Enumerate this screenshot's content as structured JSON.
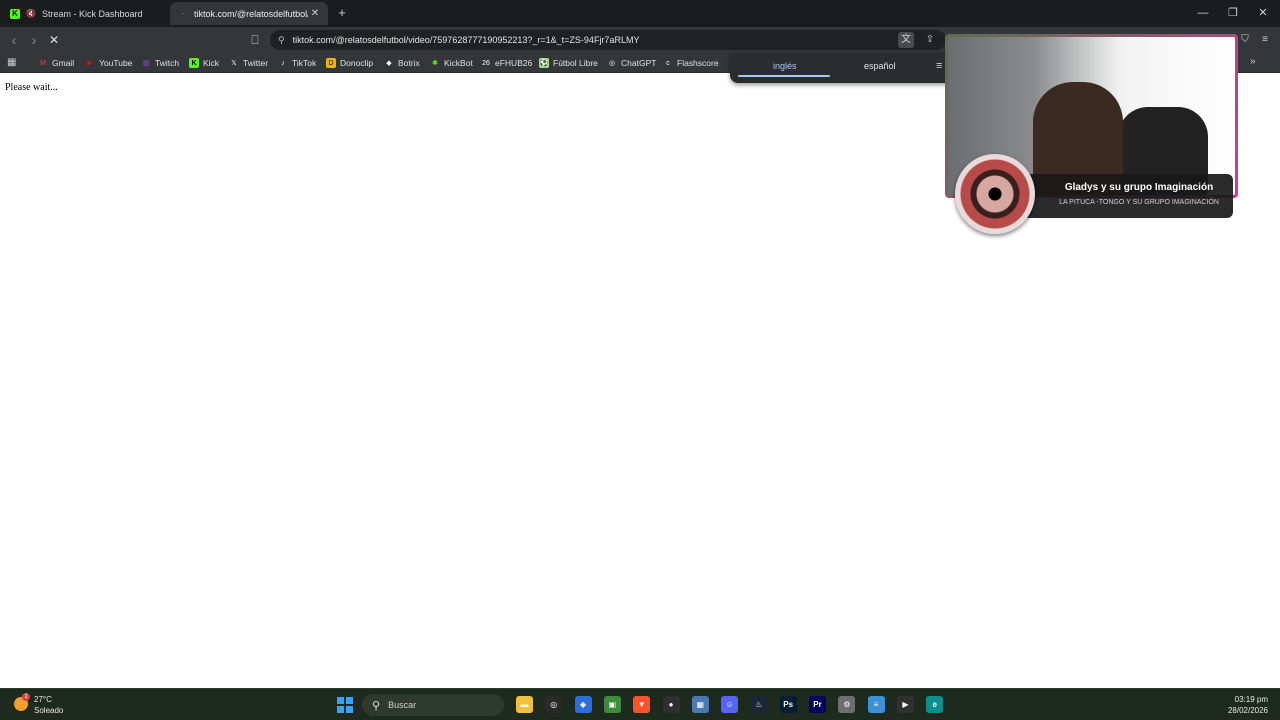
{
  "tabs": [
    {
      "title": "Stream - Kick Dashboard",
      "favicon": "kick-icon"
    },
    {
      "title": "tiktok.com/@relatosdelfutbol/v",
      "favicon": "loading-icon",
      "active": true
    }
  ],
  "toolbar": {
    "url": "tiktok.com/@relatosdelfutbol/video/7597628777190952213?_r=1&_t=ZS-94Fjr7aRLMY"
  },
  "bookmarks": [
    {
      "label": "Gmail",
      "icon": "gmail-icon",
      "color": "#ea4335"
    },
    {
      "label": "YouTube",
      "icon": "youtube-icon",
      "color": "#ff0000"
    },
    {
      "label": "Twitch",
      "icon": "twitch-icon",
      "color": "#9146ff"
    },
    {
      "label": "Kick",
      "icon": "kick-icon",
      "color": "#53fc18"
    },
    {
      "label": "Twitter",
      "icon": "x-icon",
      "color": "#ffffff"
    },
    {
      "label": "TikTok",
      "icon": "tiktok-icon",
      "color": "#ffffff"
    },
    {
      "label": "Donoclip",
      "icon": "donoclip-icon",
      "color": "#f5b400"
    },
    {
      "label": "Botrix",
      "icon": "botrix-icon",
      "color": "#ffffff"
    },
    {
      "label": "KickBot",
      "icon": "kickbot-icon",
      "color": "#53fc18"
    },
    {
      "label": "eFHUB26",
      "icon": "efhub-icon",
      "color": "#ffffff"
    },
    {
      "label": "Fútbol Libre",
      "icon": "futbol-libre-icon",
      "color": "#9fe870"
    },
    {
      "label": "ChatGPT",
      "icon": "chatgpt-icon",
      "color": "#ffffff"
    },
    {
      "label": "Flashscore",
      "icon": "flashscore-icon",
      "color": "#ffffff"
    }
  ],
  "translate": {
    "source": "inglés",
    "target": "español"
  },
  "content": {
    "message": "Please wait..."
  },
  "overlay": {
    "song_title": "Gladys y su grupo Imaginación",
    "song_subtitle": "LA PITUCA -TONGO Y SU GRUPO IMAGINACIÓN"
  },
  "taskbar": {
    "weather_temp": "27°C",
    "weather_desc": "Soleado",
    "weather_badge": "1",
    "search_label": "Buscar",
    "time": "03:19 pm",
    "date": "28/02/2026",
    "apps": [
      {
        "icon": "file-explorer-icon",
        "color": "#f0c040",
        "glyph": "▬"
      },
      {
        "icon": "chatgpt-icon",
        "color": "#2a2a2a",
        "glyph": "◎"
      },
      {
        "icon": "sourcetree-icon",
        "color": "#2a6fdb",
        "glyph": "◆"
      },
      {
        "icon": "xbox-bar-icon",
        "color": "#3c8c3c",
        "glyph": "▣"
      },
      {
        "icon": "brave-icon",
        "color": "#fb542b",
        "glyph": "▼"
      },
      {
        "icon": "obs-icon",
        "color": "#302e31",
        "glyph": "●"
      },
      {
        "icon": "calculator-icon",
        "color": "#4a7ab0",
        "glyph": "▦"
      },
      {
        "icon": "discord-icon",
        "color": "#5865f2",
        "glyph": "☺"
      },
      {
        "icon": "steam-icon",
        "color": "#1b2838",
        "glyph": "♨"
      },
      {
        "icon": "photoshop-icon",
        "color": "#001e36",
        "glyph": "Ps"
      },
      {
        "icon": "premiere-icon",
        "color": "#00005b",
        "glyph": "Pr"
      },
      {
        "icon": "settings-icon",
        "color": "#6e6e6e",
        "glyph": "⚙"
      },
      {
        "icon": "notepad-icon",
        "color": "#3d8fd6",
        "glyph": "≡"
      },
      {
        "icon": "media-player-icon",
        "color": "#303030",
        "glyph": "▶"
      },
      {
        "icon": "edge-icon",
        "color": "#0c8f8f",
        "glyph": "e"
      }
    ]
  }
}
